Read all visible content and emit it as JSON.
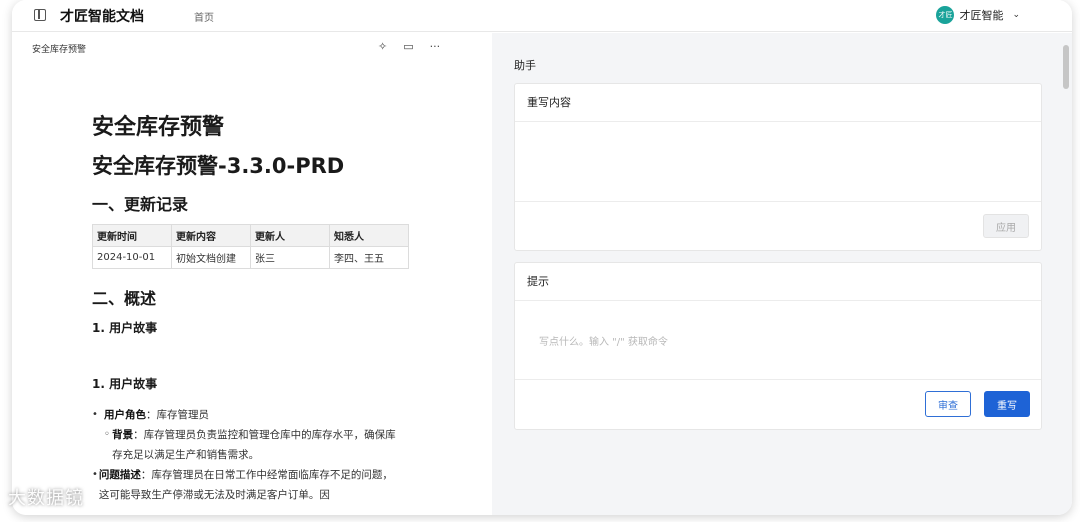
{
  "header": {
    "app_title": "才匠智能文档",
    "nav_home": "首页",
    "user_avatar_text": "才匠",
    "user_name": "才匠智能"
  },
  "doc": {
    "header_title": "安全库存预警",
    "title1": "安全库存预警",
    "title2": "安全库存预警-3.3.0-PRD",
    "section1": "一、更新记录",
    "table": {
      "headers": [
        "更新时间",
        "更新内容",
        "更新人",
        "知悉人"
      ],
      "rows": [
        [
          "2024-10-01",
          "初始文档创建",
          "张三",
          "李四、王五"
        ]
      ]
    },
    "section2": "二、概述",
    "sub1": "1. 用户故事",
    "sub2": "1. 用户故事",
    "bullets": {
      "role_label": "用户角色",
      "role_value": "：库存管理员",
      "bg_label": "背景",
      "bg_value": "：库存管理员负责监控和管理仓库中的库存水平，确保库存充足以满足生产和销售需求。",
      "problem_label": "问题描述",
      "problem_value": "：库存管理员在日常工作中经常面临库存不足的问题，这可能导致生产停滞或无法及时满足客户订单。因"
    }
  },
  "assistant": {
    "label": "助手",
    "rewrite_title": "重写内容",
    "apply_label": "应用",
    "hint_title": "提示",
    "hint_placeholder": "写点什么。输入 \"/\" 获取命令",
    "review_label": "审查",
    "rewrite_label": "重写"
  },
  "watermark": "大数据镜"
}
